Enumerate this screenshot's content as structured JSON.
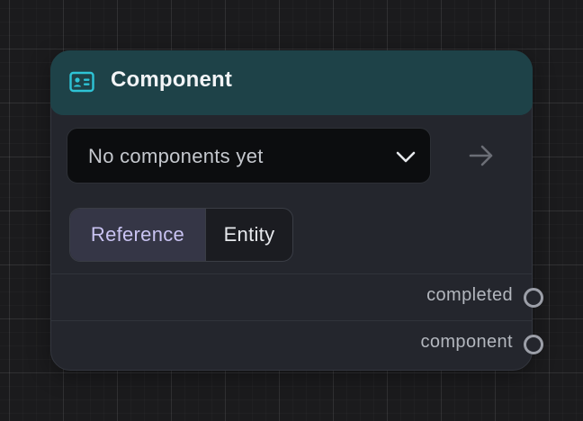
{
  "node": {
    "title": "Component",
    "header_icon": "id-card-icon",
    "colors": {
      "header_bg": "#1e4248",
      "icon_accent": "#2ec4d6",
      "body_bg": "#24262d",
      "selected_segment_text": "#c9c3f2"
    },
    "select": {
      "value": "No components yet",
      "icon": "chevron-down-icon"
    },
    "go_button": {
      "icon": "arrow-right-icon"
    },
    "segments": [
      {
        "label": "Reference",
        "selected": true
      },
      {
        "label": "Entity",
        "selected": false
      }
    ],
    "outputs": [
      {
        "label": "completed"
      },
      {
        "label": "component"
      }
    ]
  }
}
